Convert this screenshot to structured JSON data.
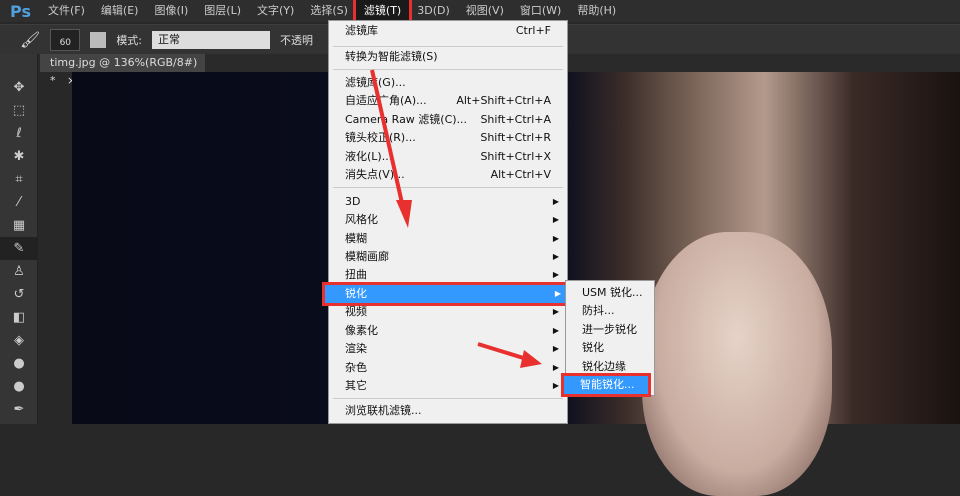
{
  "app_logo": "Ps",
  "menubar": [
    "文件(F)",
    "编辑(E)",
    "图像(I)",
    "图层(L)",
    "文字(Y)",
    "选择(S)",
    "滤镜(T)",
    "3D(D)",
    "视图(V)",
    "窗口(W)",
    "帮助(H)"
  ],
  "options": {
    "brush_size": "60",
    "mode_label": "模式:",
    "mode_value": "正常",
    "opacity_label": "不透明"
  },
  "document_tab": {
    "title": "timg.jpg @ 136%(RGB/8#) *",
    "close": "×"
  },
  "filter_menu": {
    "top": [
      {
        "label": "滤镜库",
        "shortcut": "Ctrl+F"
      },
      {
        "label": "转换为智能滤镜(S)",
        "shortcut": ""
      }
    ],
    "group1": [
      {
        "label": "滤镜库(G)...",
        "shortcut": ""
      },
      {
        "label": "自适应广角(A)...",
        "shortcut": "Alt+Shift+Ctrl+A"
      },
      {
        "label": "Camera Raw 滤镜(C)...",
        "shortcut": "Shift+Ctrl+A"
      },
      {
        "label": "镜头校正(R)...",
        "shortcut": "Shift+Ctrl+R"
      },
      {
        "label": "液化(L)...",
        "shortcut": "Shift+Ctrl+X"
      },
      {
        "label": "消失点(V)...",
        "shortcut": "Alt+Ctrl+V"
      }
    ],
    "submenus": [
      "3D",
      "风格化",
      "模糊",
      "模糊画廊",
      "扭曲",
      "锐化",
      "视频",
      "像素化",
      "渲染",
      "杂色",
      "其它"
    ],
    "bottom": "浏览联机滤镜..."
  },
  "sharpen_submenu": [
    "USM 锐化...",
    "防抖...",
    "进一步锐化",
    "锐化",
    "锐化边缘",
    "智能锐化..."
  ],
  "highlight_color": "#3399ff",
  "annotation_color": "#e8312f"
}
